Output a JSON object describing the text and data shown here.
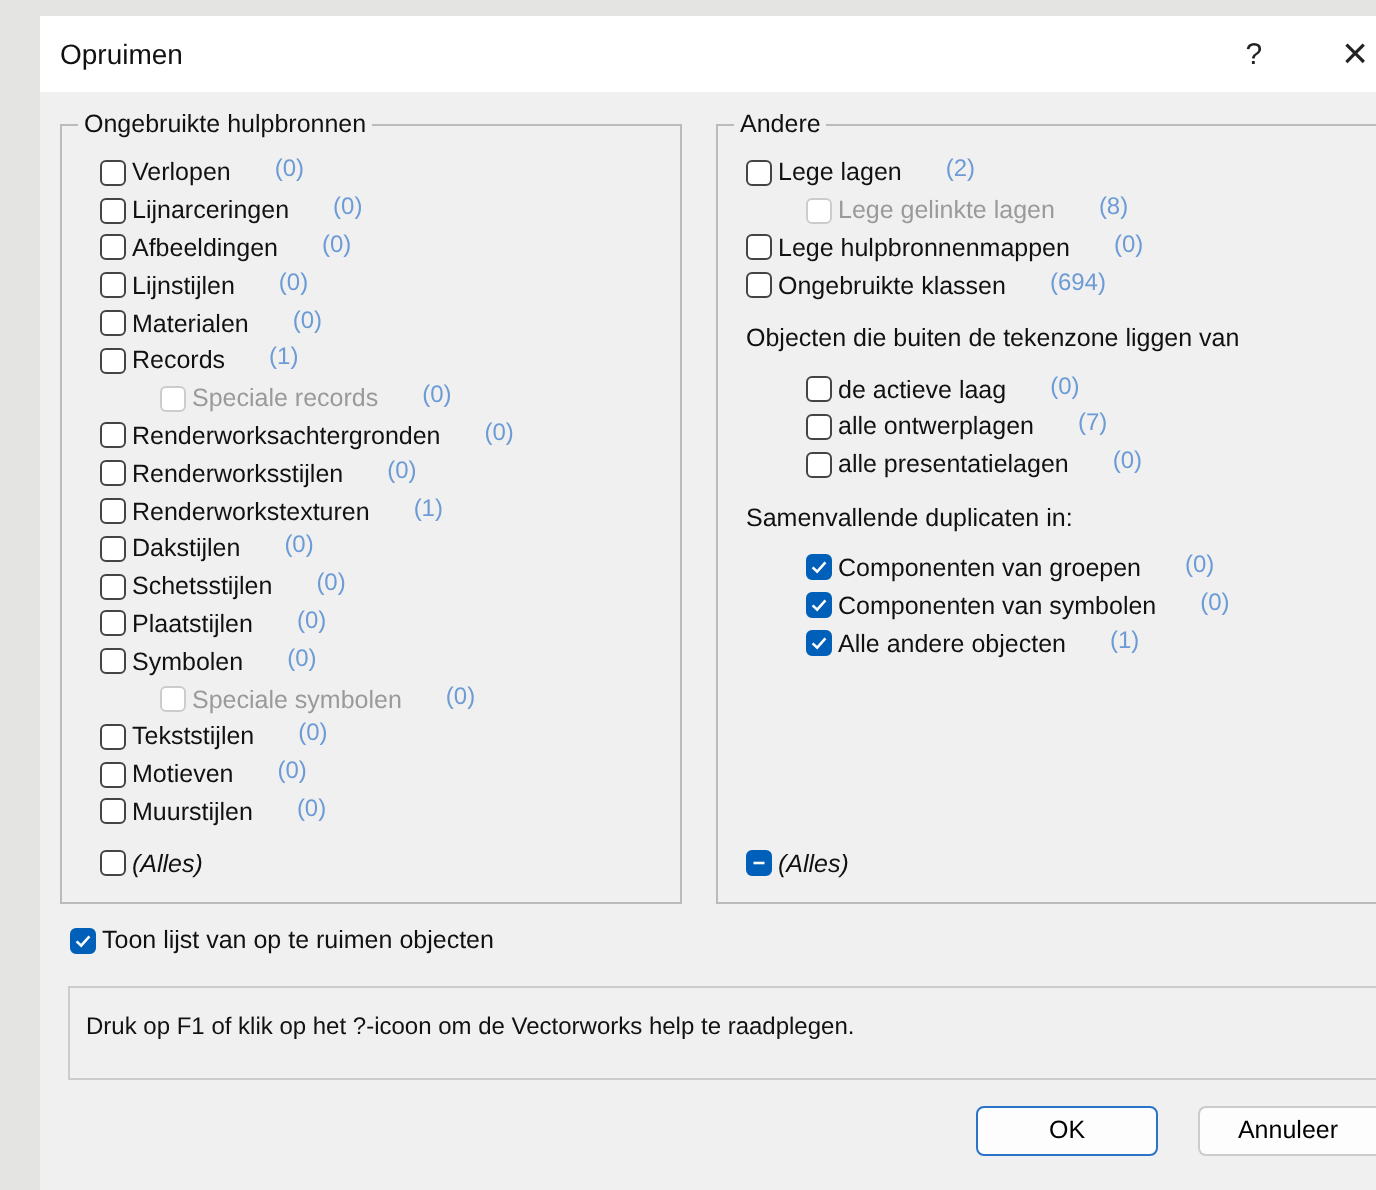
{
  "window": {
    "title": "Opruimen",
    "help": "?",
    "close": "×"
  },
  "left": {
    "title": "Ongebruikte hulpbronnen",
    "items": [
      {
        "label": "Verlopen",
        "count": "(0)",
        "checked": false,
        "disabled": false
      },
      {
        "label": "Lijnarceringen",
        "count": "(0)",
        "checked": false,
        "disabled": false
      },
      {
        "label": "Afbeeldingen",
        "count": "(0)",
        "checked": false,
        "disabled": false
      },
      {
        "label": "Lijnstijlen",
        "count": "(0)",
        "checked": false,
        "disabled": false
      },
      {
        "label": "Materialen",
        "count": "(0)",
        "checked": false,
        "disabled": false
      },
      {
        "label": "Records",
        "count": "(1)",
        "checked": false,
        "disabled": false,
        "children": [
          {
            "label": "Speciale records",
            "count": "(0)",
            "checked": false,
            "disabled": true
          }
        ]
      },
      {
        "label": "Renderworksachtergronden",
        "count": "(0)",
        "checked": false,
        "disabled": false
      },
      {
        "label": "Renderworksstijlen",
        "count": "(0)",
        "checked": false,
        "disabled": false
      },
      {
        "label": "Renderworkstexturen",
        "count": "(1)",
        "checked": false,
        "disabled": false
      },
      {
        "label": "Dakstijlen",
        "count": "(0)",
        "checked": false,
        "disabled": false
      },
      {
        "label": "Schetsstijlen",
        "count": "(0)",
        "checked": false,
        "disabled": false
      },
      {
        "label": "Plaatstijlen",
        "count": "(0)",
        "checked": false,
        "disabled": false
      },
      {
        "label": "Symbolen",
        "count": "(0)",
        "checked": false,
        "disabled": false,
        "children": [
          {
            "label": "Speciale symbolen",
            "count": "(0)",
            "checked": false,
            "disabled": true
          }
        ]
      },
      {
        "label": "Tekststijlen",
        "count": "(0)",
        "checked": false,
        "disabled": false
      },
      {
        "label": "Motieven",
        "count": "(0)",
        "checked": false,
        "disabled": false
      },
      {
        "label": "Muurstijlen",
        "count": "(0)",
        "checked": false,
        "disabled": false
      }
    ],
    "all": {
      "label": "(Alles)",
      "checked": false,
      "mixed": false
    }
  },
  "right": {
    "title": "Andere",
    "sections": [
      {
        "kind": "list",
        "items": [
          {
            "label": "Lege lagen",
            "count": "(2)",
            "checked": false,
            "disabled": false,
            "children": [
              {
                "label": "Lege gelinkte lagen",
                "count": "(8)",
                "checked": false,
                "disabled": true
              }
            ]
          },
          {
            "label": "Lege hulpbronnenmappen",
            "count": "(0)",
            "checked": false,
            "disabled": false
          },
          {
            "label": "Ongebruikte klassen",
            "count": "(694)",
            "checked": false,
            "disabled": false
          }
        ]
      },
      {
        "kind": "heading",
        "text": "Objecten die buiten de tekenzone liggen van"
      },
      {
        "kind": "sublist",
        "items": [
          {
            "label": "de actieve laag",
            "count": "(0)",
            "checked": false,
            "disabled": false
          },
          {
            "label": "alle ontwerplagen",
            "count": "(7)",
            "checked": false,
            "disabled": false
          },
          {
            "label": "alle presentatielagen",
            "count": "(0)",
            "checked": false,
            "disabled": false
          }
        ]
      },
      {
        "kind": "heading",
        "text": "Samenvallende duplicaten in:"
      },
      {
        "kind": "sublist",
        "items": [
          {
            "label": "Componenten van groepen",
            "count": "(0)",
            "checked": true,
            "disabled": false
          },
          {
            "label": "Componenten van symbolen",
            "count": "(0)",
            "checked": true,
            "disabled": false
          },
          {
            "label": "Alle andere objecten",
            "count": "(1)",
            "checked": true,
            "disabled": false
          }
        ]
      }
    ],
    "all": {
      "label": "(Alles)",
      "checked": false,
      "mixed": true
    }
  },
  "show_list": {
    "label": "Toon lijst van op te ruimen objecten",
    "checked": true
  },
  "help_text": "Druk op F1 of klik op het ?-icoon om de Vectorworks help te raadplegen.",
  "buttons": [
    {
      "label": "OK",
      "default": true
    },
    {
      "label": "Annuleer",
      "default": false
    }
  ]
}
